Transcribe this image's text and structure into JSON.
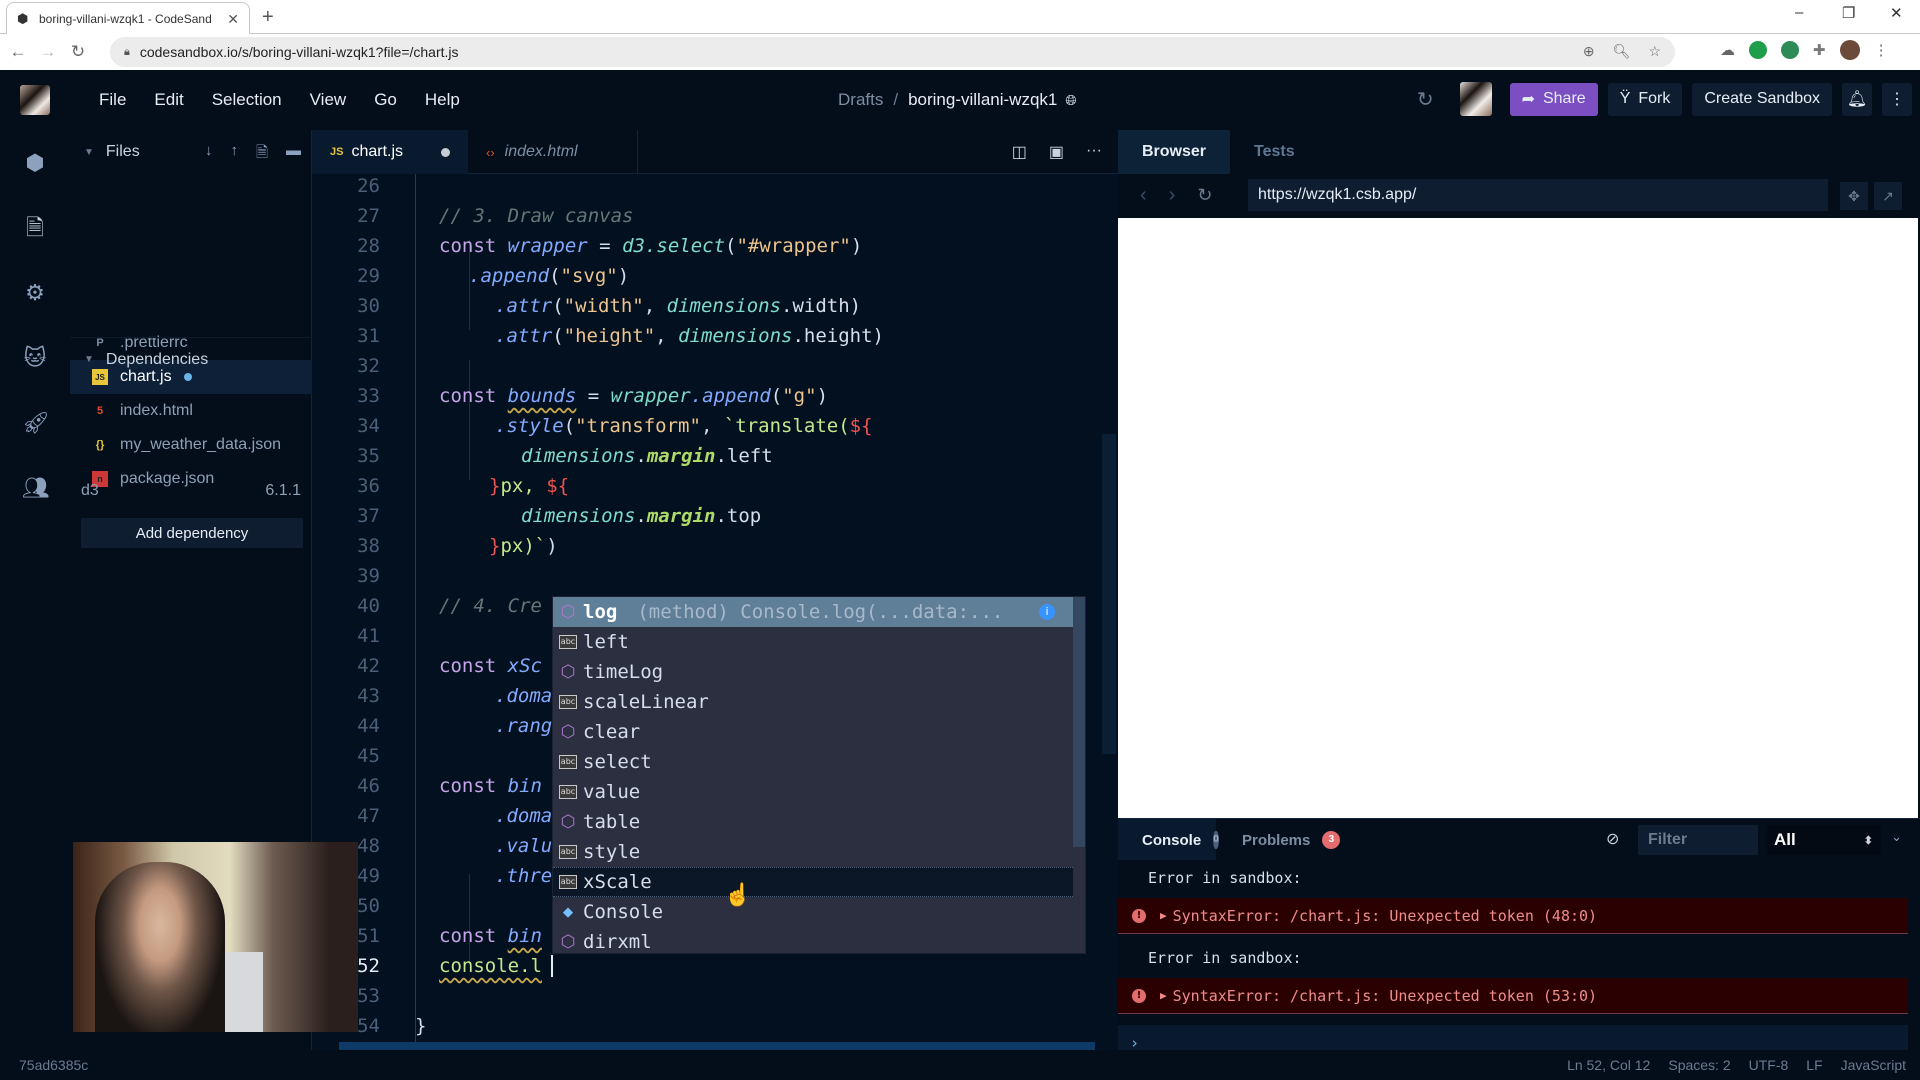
{
  "chrome": {
    "tab_title": "boring-villani-wzqk1 - CodeSand",
    "url": "codesandbox.io/s/boring-villani-wzqk1?file=/chart.js"
  },
  "header": {
    "menu": [
      "File",
      "Edit",
      "Selection",
      "View",
      "Go",
      "Help"
    ],
    "breadcrumb_root": "Drafts",
    "breadcrumb_sep": "/",
    "sandbox_name": "boring-villani-wzqk1",
    "share_label": "Share",
    "fork_label": "Fork",
    "create_label": "Create Sandbox"
  },
  "activity_bar": [
    "sandbox-info-icon",
    "explorer-icon",
    "settings-icon",
    "github-icon",
    "deploy-icon",
    "live-icon"
  ],
  "sidebar": {
    "files_label": "Files",
    "files": [
      {
        "name": ".prettierrc",
        "icon": "prettier-icon",
        "active": false
      },
      {
        "name": "chart.js",
        "icon": "js-icon",
        "active": true,
        "modified": true
      },
      {
        "name": "index.html",
        "icon": "html-icon",
        "active": false
      },
      {
        "name": "my_weather_data.json",
        "icon": "json-icon",
        "active": false
      },
      {
        "name": "package.json",
        "icon": "npm-icon",
        "active": false
      }
    ],
    "dependencies_label": "Dependencies",
    "dependencies": [
      {
        "name": "d3",
        "version": "6.1.1"
      }
    ],
    "add_dependency_label": "Add dependency"
  },
  "editor": {
    "tabs": [
      {
        "label": "chart.js",
        "active": true,
        "modified": true
      },
      {
        "label": "index.html",
        "active": false
      }
    ],
    "current_line": 52,
    "line_numbers": [
      "26",
      "27",
      "28",
      "29",
      "30",
      "31",
      "32",
      "33",
      "34",
      "35",
      "36",
      "37",
      "38",
      "39",
      "40",
      "41",
      "42",
      "43",
      "44",
      "45",
      "46",
      "47",
      "48",
      "49",
      "50",
      "51",
      "52",
      "53",
      "54"
    ],
    "visible_code": {
      "l27": "// 3. Draw canvas",
      "l28_kw": "const",
      "l28_var": "wrapper",
      "l28_eq": " = ",
      "l28_fn": "d3.select",
      "l28_open": "(",
      "l28_str": "\"#wrapper\"",
      "l28_close": ")",
      "l29_m": ".append",
      "l29_str": "\"svg\"",
      "l30_m": ".attr",
      "l30_str": "\"width\"",
      "l30_obj": "dimensions",
      "l30_prop": ".width",
      "l31_m": ".attr",
      "l31_str": "\"height\"",
      "l31_obj": "dimensions",
      "l31_prop": ".height",
      "l33_kw": "const",
      "l33_var": "bounds",
      "l33_eq": " = ",
      "l33_obj": "wrapper",
      "l33_m": ".append",
      "l33_str": "\"g\"",
      "l34_m": ".style",
      "l34_str": "\"transform\"",
      "l34_tpl": "`translate(",
      "l34_open": "${",
      "l35_obj": "dimensions",
      "l35_prop": "margin",
      "l35_end": ".left",
      "l36_close": "}",
      "l36_px": "px, ",
      "l36_open": "${",
      "l37_obj": "dimensions",
      "l37_prop": "margin",
      "l37_end": ".top",
      "l38_close": "}",
      "l38_px": "px)`",
      "l38_paren": ")",
      "l40": "// 4. Cre",
      "l42_kw": "const",
      "l42_var": "xSc",
      "l43_m": ".doma",
      "l44_m": ".rang",
      "l46_kw": "const",
      "l46_var": "bin",
      "l47_m": ".doma",
      "l48_m": ".valu",
      "l49_m": ".thre",
      "l51_kw": "const",
      "l51_var": "bin",
      "l52": "console.l",
      "l54": "}"
    }
  },
  "autocomplete": {
    "items": [
      {
        "label": "log",
        "kind": "method",
        "detail": "(method) Console.log(...data:...",
        "selected": true
      },
      {
        "label": "left",
        "kind": "text"
      },
      {
        "label": "timeLog",
        "kind": "method"
      },
      {
        "label": "scaleLinear",
        "kind": "text"
      },
      {
        "label": "clear",
        "kind": "method"
      },
      {
        "label": "select",
        "kind": "text"
      },
      {
        "label": "value",
        "kind": "text"
      },
      {
        "label": "table",
        "kind": "method"
      },
      {
        "label": "style",
        "kind": "text"
      },
      {
        "label": "xScale",
        "kind": "text",
        "hovered": true
      },
      {
        "label": "Console",
        "kind": "class"
      },
      {
        "label": "dirxml",
        "kind": "method"
      }
    ]
  },
  "preview": {
    "tabs": [
      "Browser",
      "Tests"
    ],
    "url": "https://wzqk1.csb.app/"
  },
  "console": {
    "tabs": [
      {
        "label": "Console",
        "count": "0"
      },
      {
        "label": "Problems",
        "count": "3"
      }
    ],
    "filter_placeholder": "Filter",
    "level": "All",
    "messages": [
      {
        "type": "info",
        "text": "Error in sandbox:"
      },
      {
        "type": "error",
        "text": "SyntaxError: /chart.js: Unexpected token (48:0)"
      },
      {
        "type": "info",
        "text": "Error in sandbox:"
      },
      {
        "type": "error",
        "text": "SyntaxError: /chart.js: Unexpected token (53:0)"
      }
    ],
    "prompt": "›"
  },
  "statusbar": {
    "hash": "75ad6385c",
    "position": "Ln 52, Col 12",
    "spaces": "Spaces: 2",
    "encoding": "UTF-8",
    "eol": "LF",
    "language": "JavaScript"
  }
}
